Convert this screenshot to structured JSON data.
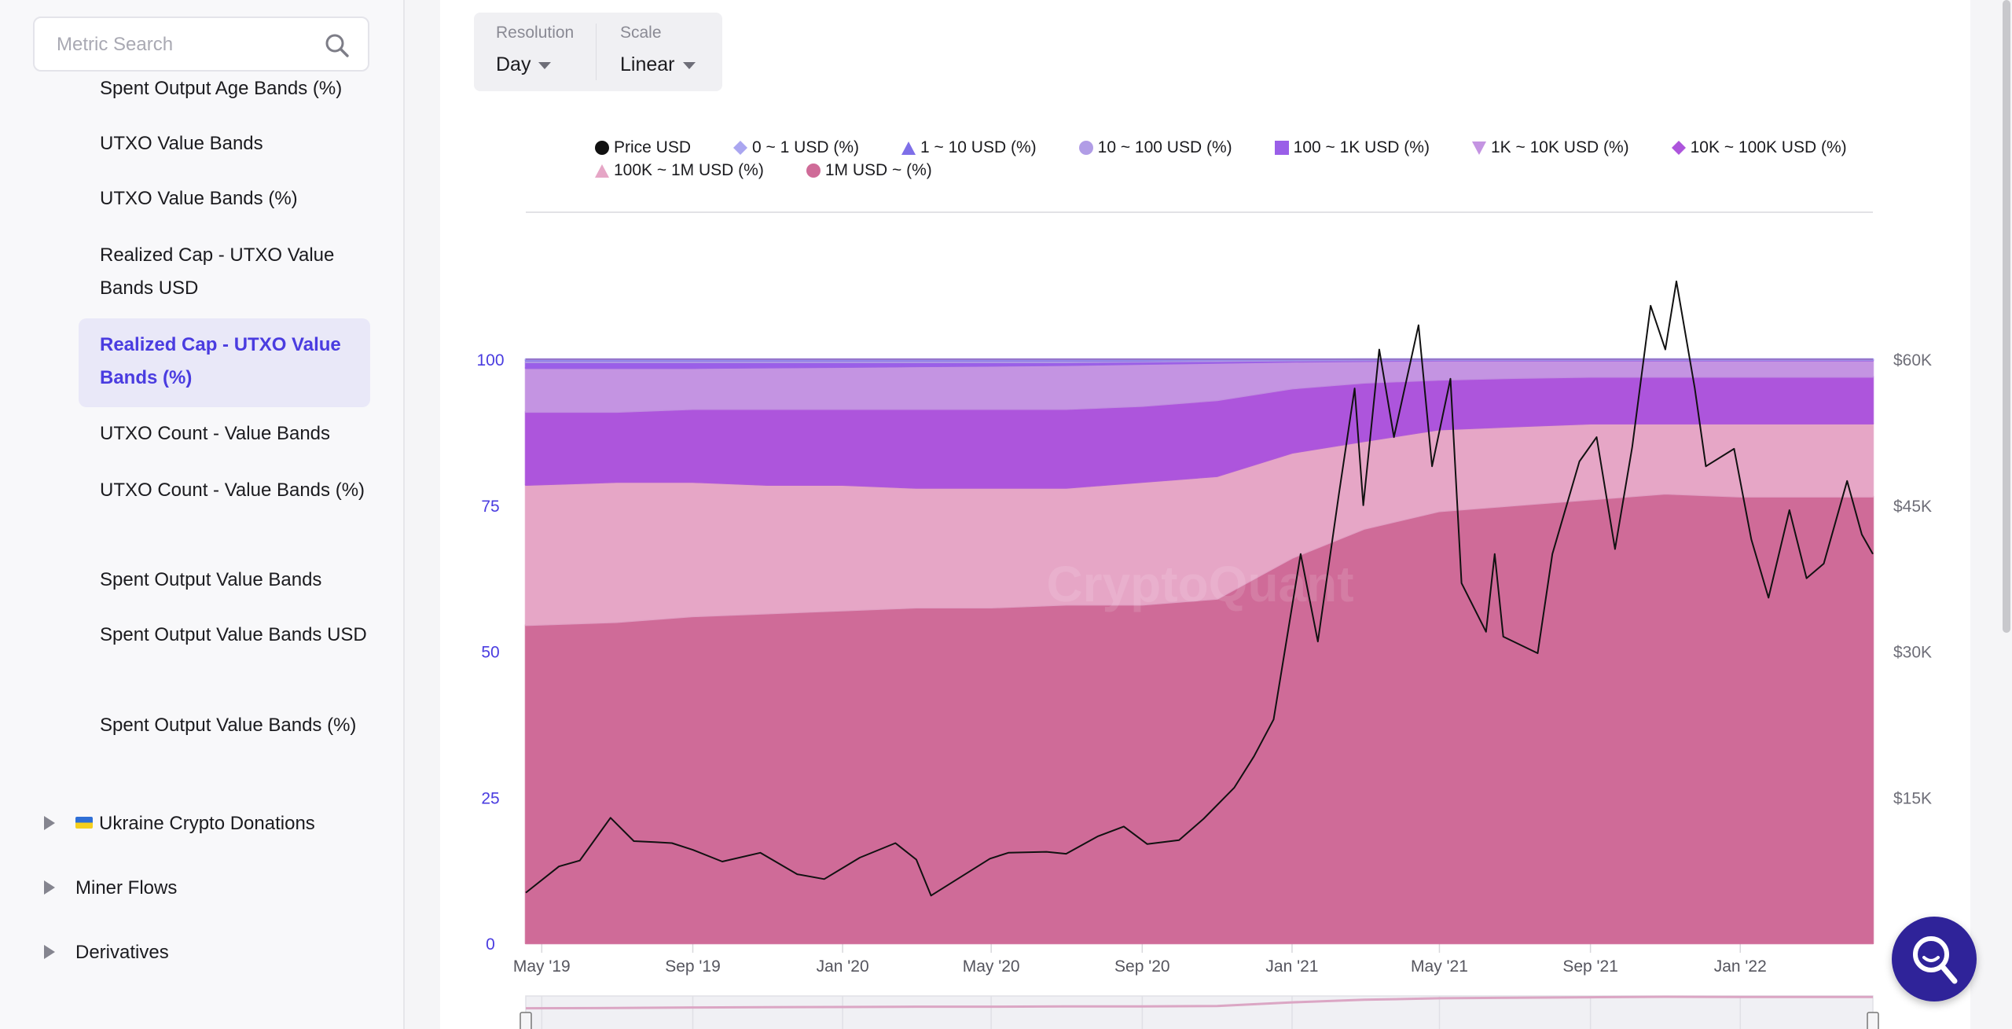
{
  "sidebar": {
    "search_placeholder": "Metric Search",
    "items": [
      {
        "label": "Spent Output Age Bands (%)"
      },
      {
        "label": "UTXO Value Bands"
      },
      {
        "label": "UTXO Value Bands (%)"
      },
      {
        "label": "Realized Cap - UTXO Value Bands USD"
      },
      {
        "label": "Realized Cap - UTXO Value Bands (%)",
        "active": true
      },
      {
        "label": "UTXO Count - Value Bands"
      },
      {
        "label": "UTXO Count - Value Bands (%)"
      },
      {
        "label": "Spent Output Value Bands"
      },
      {
        "label": "Spent Output Value Bands USD"
      },
      {
        "label": "Spent Output Value Bands (%)"
      }
    ],
    "groups": [
      {
        "label": "Ukraine Crypto Donations",
        "icon": "ukraine-flag-icon"
      },
      {
        "label": "Miner Flows"
      },
      {
        "label": "Derivatives"
      }
    ]
  },
  "controls": {
    "resolution": {
      "label": "Resolution",
      "value": "Day"
    },
    "scale": {
      "label": "Scale",
      "value": "Linear"
    }
  },
  "watermark": "CryptoQuant",
  "chart_data": {
    "type": "area",
    "stacked": true,
    "legend_placement": "top",
    "grid": true,
    "x_range": [
      "2019-04-18",
      "2022-04-19"
    ],
    "x_ticks": [
      {
        "date": "2019-05-01",
        "label": "May '19"
      },
      {
        "date": "2019-09-01",
        "label": "Sep '19"
      },
      {
        "date": "2020-01-01",
        "label": "Jan '20"
      },
      {
        "date": "2020-05-01",
        "label": "May '20"
      },
      {
        "date": "2020-09-01",
        "label": "Sep '20"
      },
      {
        "date": "2021-01-01",
        "label": "Jan '21"
      },
      {
        "date": "2021-05-01",
        "label": "May '21"
      },
      {
        "date": "2021-09-01",
        "label": "Sep '21"
      },
      {
        "date": "2022-01-01",
        "label": "Jan '22"
      }
    ],
    "y_left": {
      "range": [
        0,
        100
      ],
      "ticks": [
        {
          "v": 0,
          "label": "0"
        },
        {
          "v": 25,
          "label": "25"
        },
        {
          "v": 50,
          "label": "50"
        },
        {
          "v": 75,
          "label": "75"
        },
        {
          "v": 100,
          "label": "100"
        }
      ],
      "color": "#4a3ce0"
    },
    "y_right": {
      "range": [
        0,
        60000
      ],
      "ticks": [
        {
          "v": 15000,
          "label": "$15K"
        },
        {
          "v": 30000,
          "label": "$30K"
        },
        {
          "v": 45000,
          "label": "$45K"
        },
        {
          "v": 60000,
          "label": "$60K"
        }
      ]
    },
    "area_dates": [
      "2019-04-18",
      "2019-07-01",
      "2019-09-01",
      "2019-11-01",
      "2020-01-01",
      "2020-03-01",
      "2020-05-01",
      "2020-07-01",
      "2020-09-01",
      "2020-11-01",
      "2021-01-01",
      "2021-03-01",
      "2021-05-01",
      "2021-07-01",
      "2021-09-01",
      "2021-11-01",
      "2022-01-01",
      "2022-03-01",
      "2022-04-19"
    ],
    "series": [
      {
        "name": "1M USD ~ (%)",
        "marker": "circle",
        "color": "#cf6b98",
        "values": [
          54.5,
          55,
          56,
          56.5,
          57,
          57.5,
          57.5,
          58,
          58,
          59,
          66,
          71,
          74,
          75,
          76,
          77,
          76.5,
          76.5,
          76.5
        ]
      },
      {
        "name": "100K ~ 1M USD (%)",
        "marker": "triangle",
        "color": "#e6a6c6",
        "values": [
          24,
          24,
          23,
          22,
          21.5,
          20.5,
          20.5,
          20,
          21,
          21,
          18,
          15,
          14,
          13.5,
          13,
          12,
          12.5,
          12.5,
          12.5
        ]
      },
      {
        "name": "10K ~ 100K USD (%)",
        "marker": "diamond",
        "color": "#ad55dc",
        "values": [
          12.5,
          12,
          12.5,
          13,
          13,
          13.5,
          13.5,
          13.5,
          13,
          13,
          11,
          10,
          8.5,
          8.3,
          8,
          8,
          8,
          8,
          8
        ]
      },
      {
        "name": "1K ~ 10K USD (%)",
        "marker": "triangle-down",
        "color": "#c494e2",
        "values": [
          7.5,
          7.5,
          7,
          7.1,
          7.2,
          7.3,
          7.4,
          7.5,
          7.2,
          6.4,
          4.6,
          3.7,
          3.3,
          3,
          2.8,
          2.8,
          2.8,
          2.8,
          2.8
        ]
      },
      {
        "name": "100 ~ 1K USD (%)",
        "marker": "square",
        "color": "#9a5fe8",
        "values": [
          1.0,
          1.0,
          1.0,
          0.9,
          0.8,
          0.7,
          0.6,
          0.5,
          0.4,
          0.3,
          0.2,
          0.15,
          0.1,
          0.1,
          0.1,
          0.1,
          0.1,
          0.1,
          0.1
        ]
      },
      {
        "name": "10 ~ 100 USD (%)",
        "marker": "circle",
        "color": "#b19de6",
        "values": [
          0.3,
          0.3,
          0.3,
          0.3,
          0.3,
          0.3,
          0.3,
          0.3,
          0.2,
          0.2,
          0.1,
          0.1,
          0.05,
          0.05,
          0.05,
          0.05,
          0.05,
          0.05,
          0.05
        ]
      },
      {
        "name": "1 ~ 10 USD (%)",
        "marker": "triangle",
        "color": "#7e6fe8",
        "values": [
          0.15,
          0.15,
          0.15,
          0.15,
          0.15,
          0.15,
          0.15,
          0.15,
          0.15,
          0.05,
          0.05,
          0.03,
          0.03,
          0.03,
          0.03,
          0.03,
          0.03,
          0.03,
          0.03
        ]
      },
      {
        "name": "0 ~ 1 USD (%)",
        "marker": "diamond",
        "color": "#aaa6f0",
        "values": [
          0.05,
          0.05,
          0.05,
          0.05,
          0.05,
          0.05,
          0.05,
          0.05,
          0.05,
          0.05,
          0.05,
          0.02,
          0.02,
          0.02,
          0.02,
          0.02,
          0.02,
          0.02,
          0.02
        ]
      }
    ],
    "price": {
      "name": "Price USD",
      "marker": "circle",
      "color": "#111111",
      "axis": "right",
      "points": [
        [
          "2019-04-18",
          5200
        ],
        [
          "2019-05-15",
          7900
        ],
        [
          "2019-06-01",
          8500
        ],
        [
          "2019-06-26",
          12900
        ],
        [
          "2019-07-15",
          10500
        ],
        [
          "2019-08-01",
          10400
        ],
        [
          "2019-08-15",
          10300
        ],
        [
          "2019-09-01",
          9600
        ],
        [
          "2019-09-25",
          8400
        ],
        [
          "2019-10-26",
          9300
        ],
        [
          "2019-11-25",
          7100
        ],
        [
          "2019-12-17",
          6600
        ],
        [
          "2020-01-15",
          8800
        ],
        [
          "2020-02-13",
          10300
        ],
        [
          "2020-03-01",
          8600
        ],
        [
          "2020-03-13",
          4900
        ],
        [
          "2020-04-01",
          6400
        ],
        [
          "2020-04-30",
          8700
        ],
        [
          "2020-05-15",
          9300
        ],
        [
          "2020-06-15",
          9400
        ],
        [
          "2020-07-01",
          9200
        ],
        [
          "2020-07-27",
          11000
        ],
        [
          "2020-08-17",
          12000
        ],
        [
          "2020-09-05",
          10200
        ],
        [
          "2020-10-01",
          10600
        ],
        [
          "2020-10-21",
          12800
        ],
        [
          "2020-11-15",
          16000
        ],
        [
          "2020-12-01",
          19200
        ],
        [
          "2020-12-17",
          23000
        ],
        [
          "2021-01-08",
          40000
        ],
        [
          "2021-01-22",
          31000
        ],
        [
          "2021-02-08",
          46000
        ],
        [
          "2021-02-21",
          57000
        ],
        [
          "2021-02-28",
          45000
        ],
        [
          "2021-03-13",
          61000
        ],
        [
          "2021-03-25",
          52000
        ],
        [
          "2021-04-14",
          63500
        ],
        [
          "2021-04-25",
          49000
        ],
        [
          "2021-05-10",
          58000
        ],
        [
          "2021-05-19",
          37000
        ],
        [
          "2021-06-08",
          32000
        ],
        [
          "2021-06-15",
          40000
        ],
        [
          "2021-06-22",
          31500
        ],
        [
          "2021-07-20",
          29800
        ],
        [
          "2021-08-01",
          40000
        ],
        [
          "2021-08-23",
          49500
        ],
        [
          "2021-09-06",
          52000
        ],
        [
          "2021-09-21",
          40500
        ],
        [
          "2021-10-05",
          51000
        ],
        [
          "2021-10-20",
          65500
        ],
        [
          "2021-11-01",
          61000
        ],
        [
          "2021-11-10",
          68000
        ],
        [
          "2021-11-25",
          57000
        ],
        [
          "2021-12-04",
          49000
        ],
        [
          "2021-12-27",
          50800
        ],
        [
          "2022-01-10",
          41500
        ],
        [
          "2022-01-24",
          35500
        ],
        [
          "2022-02-10",
          44500
        ],
        [
          "2022-02-24",
          37500
        ],
        [
          "2022-03-10",
          39000
        ],
        [
          "2022-03-29",
          47500
        ],
        [
          "2022-04-10",
          42000
        ],
        [
          "2022-04-19",
          40000
        ]
      ]
    },
    "legend_order": [
      "Price USD",
      "0 ~ 1 USD (%)",
      "1 ~ 10 USD (%)",
      "10 ~ 100 USD (%)",
      "100 ~ 1K USD (%)",
      "1K ~ 10K USD (%)",
      "10K ~ 100K USD (%)",
      "100K ~ 1M USD (%)",
      "1M USD ~ (%)"
    ]
  }
}
